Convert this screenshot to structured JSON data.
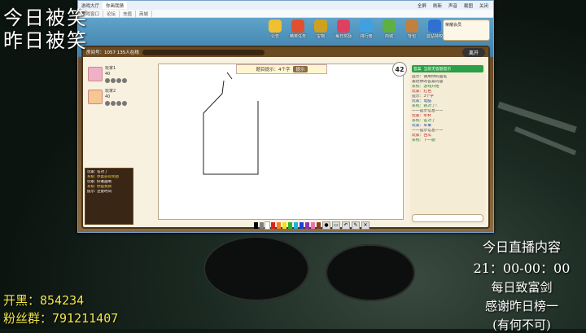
{
  "overlay": {
    "line1": "今日被笑",
    "line2": "昨日被笑",
    "open_black": "开黑：854234",
    "fan_group": "粉丝群：791211407",
    "schedule_title": "今日直播内容",
    "schedule_time": "21：00-00：00",
    "schedule_item": "每日致富剑",
    "thanks": "感谢昨日榜一",
    "thanks_name": "(有何不可)"
  },
  "browser": {
    "tabs": [
      "游戏大厅",
      "你画我猜"
    ],
    "nav": [
      "游戏窗口",
      "论坛",
      "充值",
      "商城"
    ],
    "tools": [
      "全屏",
      "刷新",
      "声音",
      "截图",
      "关闭"
    ]
  },
  "game": {
    "top_icons": [
      "公告",
      "精英任务",
      "宝物",
      "每日奖励",
      "排行榜",
      "商城",
      "背包",
      "蓝钻特权"
    ],
    "profile_name": "荣耀会员",
    "room_title": "房间号：1057 135人在线",
    "exit": "离开",
    "players": [
      {
        "name": "玩家1",
        "score": "40"
      },
      {
        "name": "玩家2",
        "score": "40"
      }
    ],
    "chat_lines": [
      {
        "text": "玩家: 答对了",
        "hl": false
      },
      {
        "text": "系统: 恭喜获得奖励",
        "hl": true
      },
      {
        "text": "玩家: 好难画啊",
        "hl": false
      },
      {
        "text": "系统: 你画我猜",
        "hl": true
      },
      {
        "text": "提示: 注意时间",
        "hl": false
      }
    ],
    "canvas_hint": "题目提示：4个字",
    "canvas_btn": "提示",
    "timer": "42",
    "answer_label": "答案",
    "answer_text": "当前无答题提示",
    "right_lines": [
      {
        "text": "提示：请用你的画笔",
        "cls": ""
      },
      {
        "text": "表达你的答案内容",
        "cls": ""
      },
      {
        "text": "系统：游戏开始",
        "cls": "green"
      },
      {
        "text": "玩家：红色",
        "cls": "red"
      },
      {
        "text": "提示：3个字",
        "cls": ""
      },
      {
        "text": "玩家：电脑",
        "cls": "blue"
      },
      {
        "text": "系统：猜对了！",
        "cls": "green"
      },
      {
        "text": "——提示信息——",
        "cls": ""
      },
      {
        "text": "玩家：水杯",
        "cls": "red"
      },
      {
        "text": "系统：答对了",
        "cls": "green"
      },
      {
        "text": "玩家：苹果",
        "cls": "blue"
      },
      {
        "text": "——提示信息——",
        "cls": ""
      },
      {
        "text": "玩家：西瓜",
        "cls": "red"
      },
      {
        "text": "系统：下一题",
        "cls": "green"
      }
    ],
    "colors": [
      "#000000",
      "#7f7f7f",
      "#ffffff",
      "#e02020",
      "#f08020",
      "#f0e020",
      "#30b030",
      "#20b0e0",
      "#2040d0",
      "#9030c0",
      "#f070b0",
      "#804020"
    ]
  }
}
